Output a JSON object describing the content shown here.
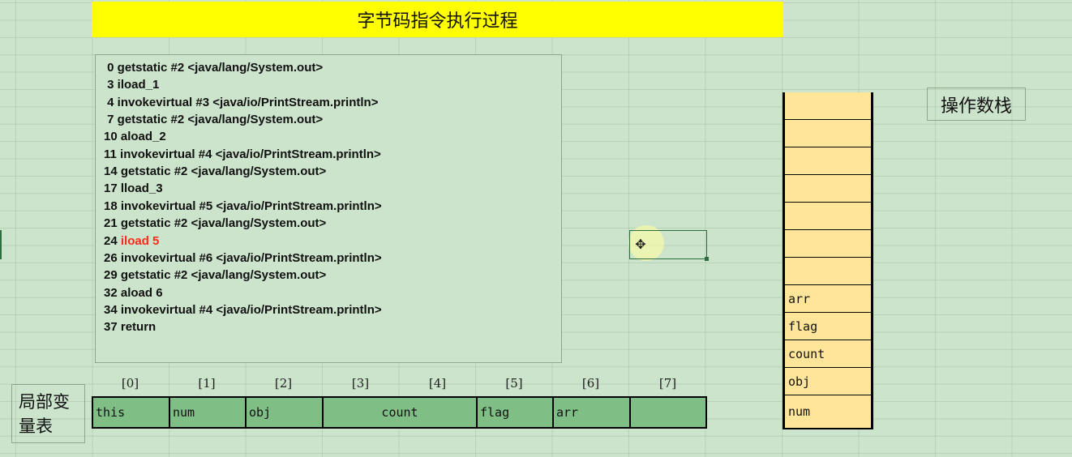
{
  "title": "字节码指令执行过程",
  "bytecode": [
    {
      "text": " 0 getstatic #2 <java/lang/System.out>",
      "highlight": false
    },
    {
      "text": " 3 iload_1",
      "highlight": false
    },
    {
      "text": " 4 invokevirtual #3 <java/io/PrintStream.println>",
      "highlight": false
    },
    {
      "text": " 7 getstatic #2 <java/lang/System.out>",
      "highlight": false
    },
    {
      "text": "10 aload_2",
      "highlight": false
    },
    {
      "text": "11 invokevirtual #4 <java/io/PrintStream.println>",
      "highlight": false
    },
    {
      "text": "14 getstatic #2 <java/lang/System.out>",
      "highlight": false
    },
    {
      "text": "17 lload_3",
      "highlight": false
    },
    {
      "text": "18 invokevirtual #5 <java/io/PrintStream.println>",
      "highlight": false
    },
    {
      "text": "21 getstatic #2 <java/lang/System.out>",
      "highlight": false
    },
    {
      "prefix": "24 ",
      "hl": "iload 5",
      "highlight": true
    },
    {
      "text": "26 invokevirtual #6 <java/io/PrintStream.println>",
      "highlight": false
    },
    {
      "text": "29 getstatic #2 <java/lang/System.out>",
      "highlight": false
    },
    {
      "text": "32 aload 6",
      "highlight": false
    },
    {
      "text": "34 invokevirtual #4 <java/io/PrintStream.println>",
      "highlight": false
    },
    {
      "text": "37 return",
      "highlight": false
    }
  ],
  "operand_stack": {
    "label": "操作数栈",
    "cells": [
      "",
      "",
      "",
      "",
      "",
      "",
      "",
      "arr",
      "flag",
      "count",
      "obj",
      "num"
    ]
  },
  "local_vars": {
    "label_line1": "局部变",
    "label_line2": "量表",
    "indices": [
      "[0]",
      "[1]",
      "[2]",
      "[3]",
      "[4]",
      "[5]",
      "[6]",
      "[7]"
    ],
    "slots": [
      "this",
      "num",
      "obj",
      "count",
      "flag",
      "arr",
      ""
    ]
  },
  "colors": {
    "background": "#cce3cc",
    "title_bar": "#ffff00",
    "highlight_text": "#ff2a1a",
    "stack_cell": "#ffe599",
    "local_var_cell": "#7fbf85"
  },
  "icons": {
    "cursor": "plus-cursor-icon"
  }
}
